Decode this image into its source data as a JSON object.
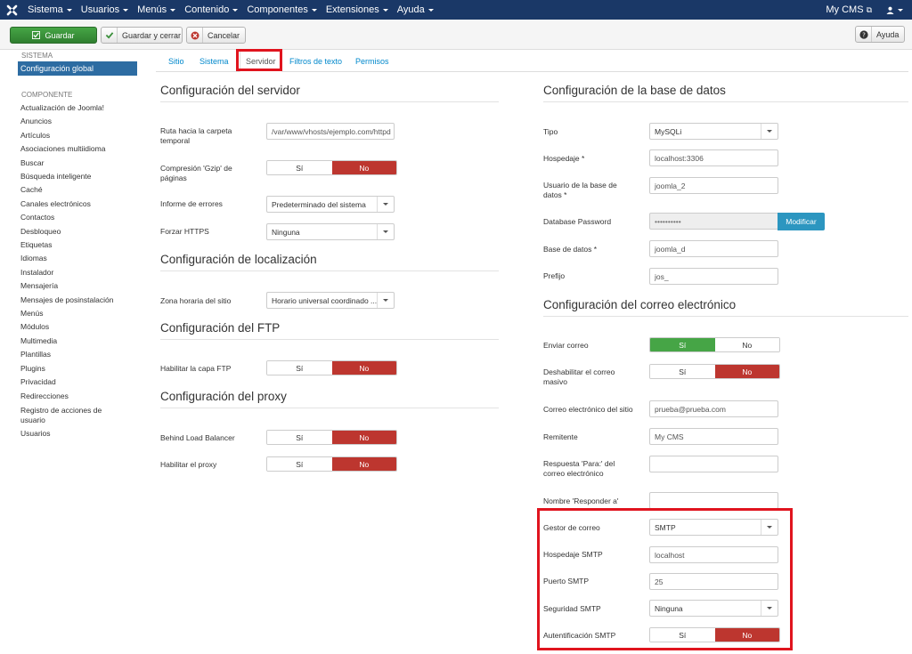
{
  "nav": {
    "menu": [
      "Sistema",
      "Usuarios",
      "Menús",
      "Contenido",
      "Componentes",
      "Extensiones",
      "Ayuda"
    ],
    "brand": "My CMS"
  },
  "toolbar": {
    "save": "Guardar",
    "save_close": "Guardar y cerrar",
    "cancel": "Cancelar",
    "help": "Ayuda"
  },
  "sidebar": {
    "system_head": "SISTEMA",
    "active": "Configuración global",
    "component_head": "COMPONENTE",
    "items": [
      "Actualización de Joomla!",
      "Anuncios",
      "Artículos",
      "Asociaciones multiidioma",
      "Buscar",
      "Búsqueda inteligente",
      "Caché",
      "Canales electrónicos",
      "Contactos",
      "Desbloqueo",
      "Etiquetas",
      "Idiomas",
      "Instalador",
      "Mensajería",
      "Mensajes de posinstalación",
      "Menús",
      "Módulos",
      "Multimedia",
      "Plantillas",
      "Plugins",
      "Privacidad",
      "Redirecciones",
      "Registro de acciones de usuario",
      "Usuarios"
    ]
  },
  "tabs": [
    "Sitio",
    "Sistema",
    "Servidor",
    "Filtros de texto",
    "Permisos"
  ],
  "toggle": {
    "yes": "Sí",
    "no": "No"
  },
  "server": {
    "title": "Configuración del servidor",
    "tmp_label": "Ruta hacia la carpeta temporal",
    "tmp_value": "/var/www/vhosts/ejemplo.com/httpd",
    "gzip_label": "Compresión 'Gzip' de páginas",
    "errors_label": "Informe de errores",
    "errors_value": "Predeterminado del sistema",
    "https_label": "Forzar HTTPS",
    "https_value": "Ninguna"
  },
  "locale": {
    "title": "Configuración de localización",
    "tz_label": "Zona horaria del sitio",
    "tz_value": "Horario universal coordinado ..."
  },
  "ftp": {
    "title": "Configuración del FTP",
    "enable_label": "Habilitar la capa FTP"
  },
  "proxy": {
    "title": "Configuración del proxy",
    "lb_label": "Behind Load Balancer",
    "enable_label": "Habilitar el proxy"
  },
  "db": {
    "title": "Configuración de la base de datos",
    "type_label": "Tipo",
    "type_value": "MySQLi",
    "host_label": "Hospedaje *",
    "host_value": "localhost:3306",
    "user_label": "Usuario de la base de datos *",
    "user_value": "joomla_2",
    "pass_label": "Database Password",
    "pass_value": "••••••••••",
    "pass_button": "Modificar",
    "name_label": "Base de datos *",
    "name_value": "joomla_d",
    "prefix_label": "Prefijo",
    "prefix_value": "jos_"
  },
  "mail": {
    "title": "Configuración del correo electrónico",
    "send_label": "Enviar correo",
    "mass_label": "Deshabilitar el correo masivo",
    "from_email_label": "Correo electrónico del sitio",
    "from_email_value": "prueba@prueba.com",
    "from_name_label": "Remitente",
    "from_name_value": "My CMS",
    "reply_to_label": "Respuesta 'Para:' del correo electrónico",
    "reply_name_label": "Nombre 'Responder a'",
    "mailer_label": "Gestor de correo",
    "mailer_value": "SMTP",
    "smtp_host_label": "Hospedaje SMTP",
    "smtp_host_value": "localhost",
    "smtp_port_label": "Puerto SMTP",
    "smtp_port_value": "25",
    "smtp_sec_label": "Seguridad SMTP",
    "smtp_sec_value": "Ninguna",
    "smtp_auth_label": "Autentificación SMTP"
  },
  "colors": {
    "navbar": "#1a3867",
    "highlight": "#e0141e",
    "on_red": "#bd362f",
    "on_green": "#46a546",
    "accent": "#2d6ca2"
  }
}
